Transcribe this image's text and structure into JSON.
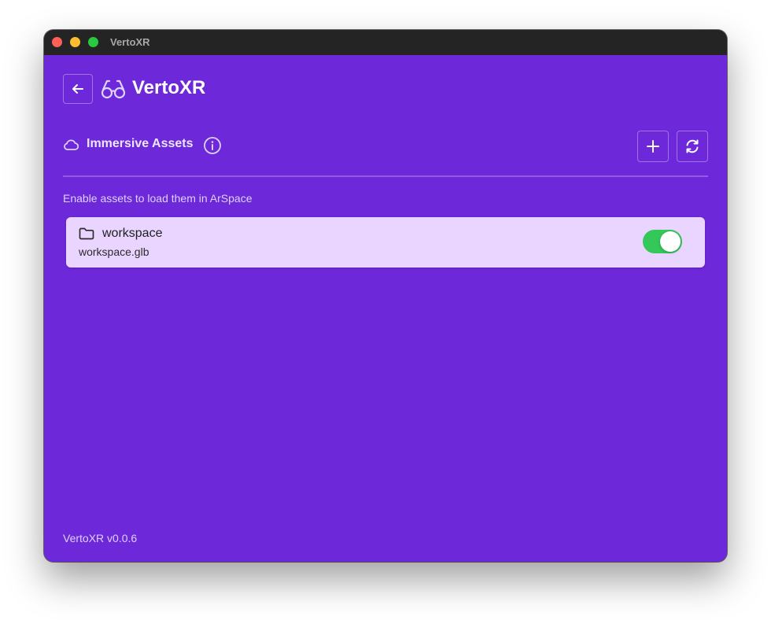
{
  "window": {
    "title": "VertoXR"
  },
  "header": {
    "brand_name": "VertoXR",
    "back_icon": "arrow-left-icon",
    "brand_icon": "glasses-icon"
  },
  "section": {
    "title": "Immersive Assets",
    "icon": "cloud-icon",
    "info_icon": "info-icon",
    "add_icon": "plus-icon",
    "refresh_icon": "refresh-icon",
    "hint": "Enable assets to load them in ArSpace"
  },
  "assets": [
    {
      "name": "workspace",
      "file": "workspace.glb",
      "icon": "folder-icon",
      "enabled": true
    }
  ],
  "footer": {
    "version": "VertoXR v0.0.6"
  },
  "colors": {
    "background": "#6d28d9",
    "card": "#e9d5ff",
    "toggle_on": "#34c759",
    "titlebar": "#242424"
  }
}
